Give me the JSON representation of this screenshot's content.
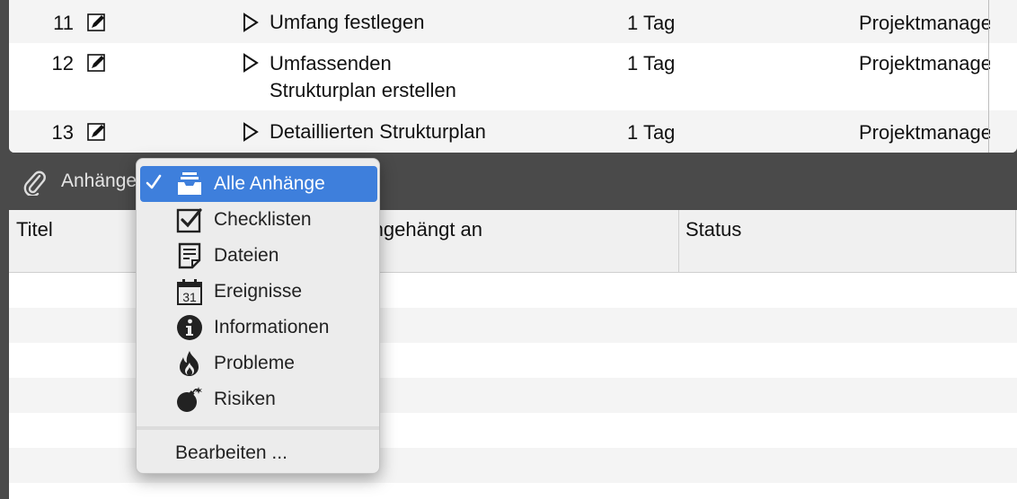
{
  "tasks": [
    {
      "num": "11",
      "name": "Umfang festlegen",
      "duration": "1 Tag",
      "resource": "Projektmanager"
    },
    {
      "num": "12",
      "name_line1": "Umfassenden",
      "name_line2": "Strukturplan erstellen",
      "duration": "1 Tag",
      "resource": "Projektmanager"
    },
    {
      "num": "13",
      "name": "Detaillierten Strukturplan",
      "duration": "1 Tag",
      "resource": "Projektmanager"
    }
  ],
  "attachments_bar": {
    "label": "Anhänge",
    "icon": "paperclip-icon"
  },
  "attachments_table": {
    "columns": [
      "Titel",
      "Angehängt an",
      "Status"
    ]
  },
  "menu": {
    "items": [
      {
        "label": "Alle Anhänge",
        "icon": "inbox-tray-icon",
        "selected": true
      },
      {
        "label": "Checklisten",
        "icon": "checkbox-icon",
        "selected": false
      },
      {
        "label": "Dateien",
        "icon": "document-icon",
        "selected": false
      },
      {
        "label": "Ereignisse",
        "icon": "calendar-icon",
        "calendar_day": "31",
        "selected": false
      },
      {
        "label": "Informationen",
        "icon": "info-icon",
        "selected": false
      },
      {
        "label": "Probleme",
        "icon": "fire-icon",
        "selected": false
      },
      {
        "label": "Risiken",
        "icon": "bomb-icon",
        "selected": false
      }
    ],
    "edit_label": "Bearbeiten ..."
  },
  "colors": {
    "selection": "#3e7fdc",
    "toolbar": "#4a4a4a"
  }
}
